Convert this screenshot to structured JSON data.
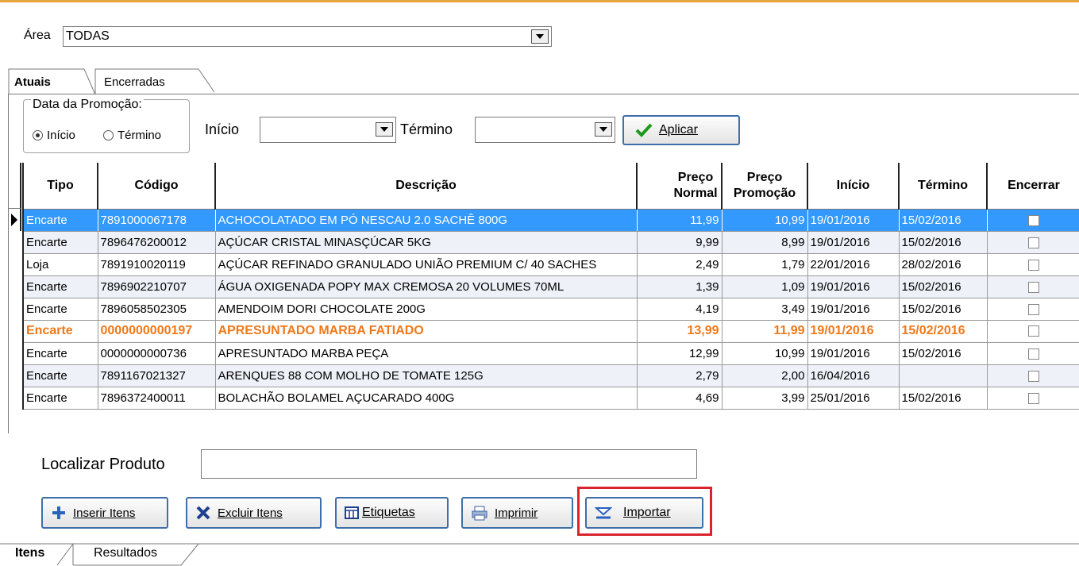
{
  "area": {
    "label": "Área",
    "value": "TODAS"
  },
  "tabs_top": [
    {
      "label": "Atuais"
    },
    {
      "label": "Encerradas"
    }
  ],
  "date_group": {
    "title": "Data da Promoção:",
    "options": [
      {
        "label": "Início",
        "selected": true
      },
      {
        "label": "Término",
        "selected": false
      }
    ]
  },
  "filters": {
    "inicio_label": "Início",
    "termino_label": "Término",
    "apply_label": "Aplicar"
  },
  "table": {
    "columns": [
      "Tipo",
      "Código",
      "Descrição",
      "Preço Normal",
      "Preço Promoção",
      "Início",
      "Término",
      "Encerrar"
    ],
    "rows": [
      {
        "tipo": "Encarte",
        "codigo": "7891000067178",
        "descricao": "ACHOCOLATADO EM PÓ NESCAU 2.0 SACHÊ 800G",
        "normal": "11,99",
        "promo": "10,99",
        "inicio": "19/01/2016",
        "termino": "15/02/2016"
      },
      {
        "tipo": "Encarte",
        "codigo": "7896476200012",
        "descricao": "AÇÚCAR CRISTAL MINASÇÚCAR 5KG",
        "normal": "9,99",
        "promo": "8,99",
        "inicio": "19/01/2016",
        "termino": "15/02/2016"
      },
      {
        "tipo": "Loja",
        "codigo": "7891910020119",
        "descricao": "AÇÚCAR REFINADO GRANULADO UNIÃO PREMIUM C/ 40 SACHES",
        "normal": "2,49",
        "promo": "1,79",
        "inicio": "22/01/2016",
        "termino": "28/02/2016"
      },
      {
        "tipo": "Encarte",
        "codigo": "7896902210707",
        "descricao": "ÁGUA OXIGENADA POPY MAX CREMOSA 20 VOLUMES 70ML",
        "normal": "1,39",
        "promo": "1,09",
        "inicio": "19/01/2016",
        "termino": "15/02/2016"
      },
      {
        "tipo": "Encarte",
        "codigo": "7896058502305",
        "descricao": "AMENDOIM DORI CHOCOLATE 200G",
        "normal": "4,19",
        "promo": "3,49",
        "inicio": "19/01/2016",
        "termino": "15/02/2016"
      },
      {
        "tipo": "Encarte",
        "codigo": "0000000000197",
        "descricao": "APRESUNTADO MARBA FATIADO",
        "normal": "13,99",
        "promo": "11,99",
        "inicio": "19/01/2016",
        "termino": "15/02/2016"
      },
      {
        "tipo": "Encarte",
        "codigo": "0000000000736",
        "descricao": "APRESUNTADO MARBA PEÇA",
        "normal": "12,99",
        "promo": "10,99",
        "inicio": "19/01/2016",
        "termino": "15/02/2016"
      },
      {
        "tipo": "Encarte",
        "codigo": "7891167021327",
        "descricao": "ARENQUES 88 COM MOLHO DE TOMATE 125G",
        "normal": "2,79",
        "promo": "2,00",
        "inicio": "16/04/2016",
        "termino": ""
      },
      {
        "tipo": "Encarte",
        "codigo": "7896372400011",
        "descricao": "BOLACHÃO BOLAMEL AÇUCARADO 400G",
        "normal": "4,69",
        "promo": "3,99",
        "inicio": "25/01/2016",
        "termino": "15/02/2016"
      }
    ]
  },
  "find": {
    "label": "Localizar Produto",
    "value": ""
  },
  "actions": [
    {
      "label": "Inserir Itens",
      "icon": "plus-icon"
    },
    {
      "label": "Excluir Itens",
      "icon": "x-icon"
    },
    {
      "label": "Etiquetas",
      "icon": "label-icon"
    },
    {
      "label": "Imprimir",
      "icon": "printer-icon"
    },
    {
      "label": "Importar",
      "icon": "import-icon"
    }
  ],
  "tabs_bottom": [
    {
      "label": "Itens"
    },
    {
      "label": "Resultados"
    }
  ],
  "colors": {
    "selected_row": "#3399ff",
    "highlight_text": "#f07818",
    "button_border": "#3e6fa8",
    "callout": "#d9232d",
    "top_line": "#e8a33a"
  }
}
